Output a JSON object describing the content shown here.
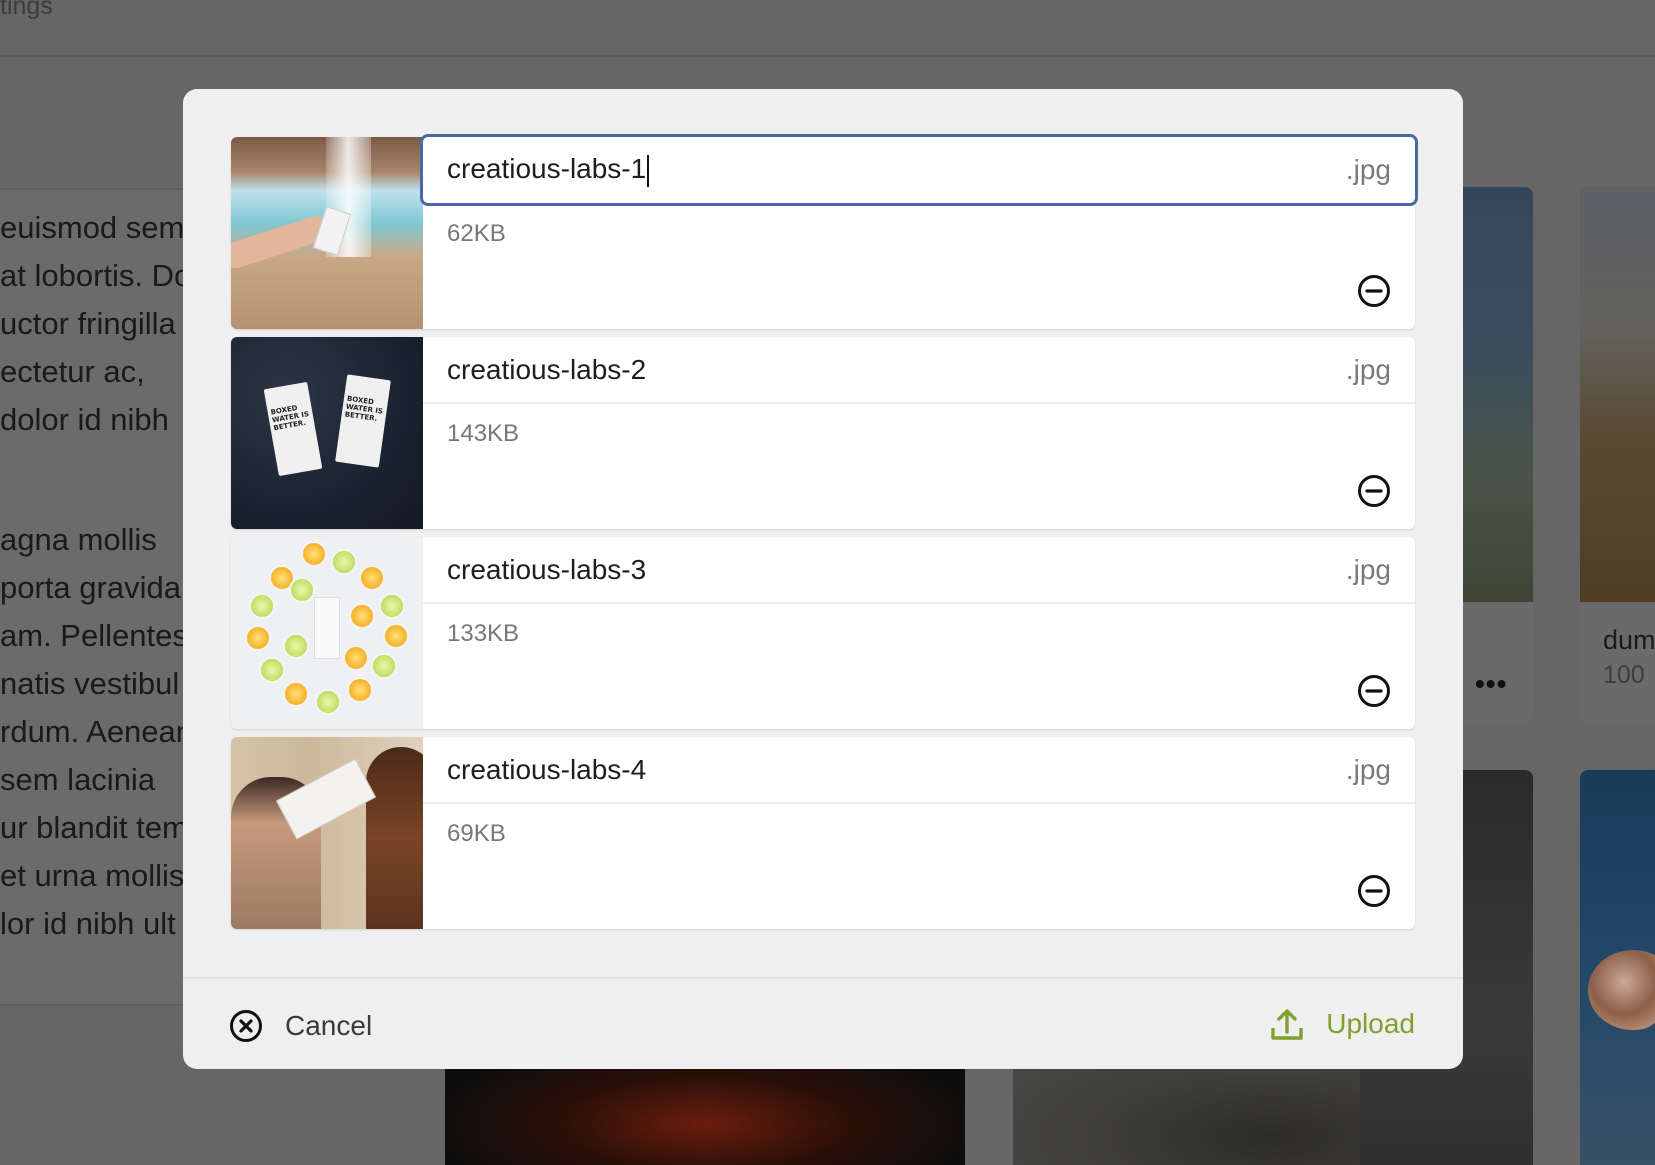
{
  "background": {
    "topbar_title": "tings",
    "text_lines": [
      "euismod sem",
      "at lobortis. Do",
      "uctor fringilla",
      "ectetur ac,",
      "dolor id nibh",
      "agna mollis",
      "porta gravida",
      "am. Pellentes",
      "natis vestibul",
      "rdum. Aenean",
      "sem lacinia",
      "ur blandit tem",
      "et urna mollis",
      "lor id nibh ult"
    ],
    "card_caption": "dum",
    "card_subcaption": "100",
    "more_glyph": "•••"
  },
  "modal": {
    "files": [
      {
        "name": "creatious-labs-1",
        "ext": ".jpg",
        "size": "62KB",
        "focused": true
      },
      {
        "name": "creatious-labs-2",
        "ext": ".jpg",
        "size": "143KB",
        "focused": false
      },
      {
        "name": "creatious-labs-3",
        "ext": ".jpg",
        "size": "133KB",
        "focused": false
      },
      {
        "name": "creatious-labs-4",
        "ext": ".jpg",
        "size": "69KB",
        "focused": false
      }
    ],
    "footer": {
      "cancel_label": "Cancel",
      "upload_label": "Upload"
    }
  },
  "colors": {
    "accent_upload": "#7fa02f",
    "focus_border": "#4a68a8",
    "overlay": "#666666"
  },
  "icons": {
    "remove": "minus-circle-icon",
    "cancel": "x-circle-icon",
    "upload": "upload-arrow-icon"
  }
}
